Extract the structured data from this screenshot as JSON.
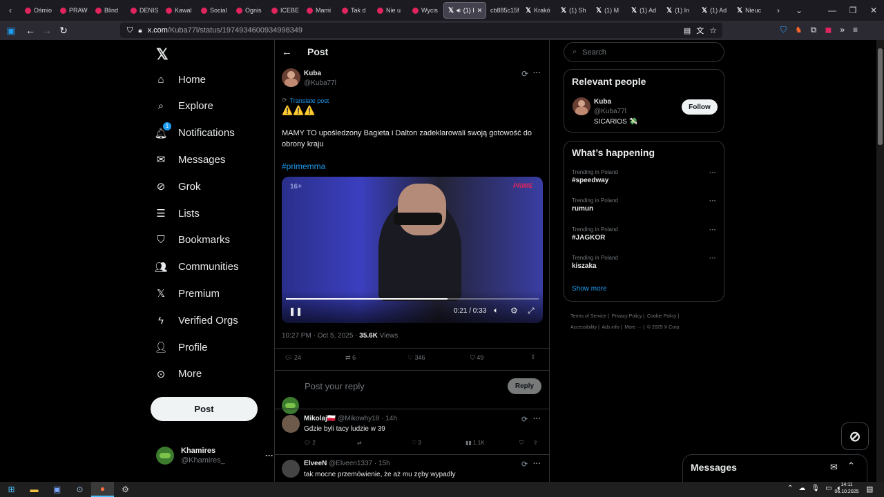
{
  "browser": {
    "tabs": [
      {
        "label": "Ośmio",
        "icon": "youtube-icon"
      },
      {
        "label": "PRAW",
        "icon": "youtube-icon"
      },
      {
        "label": "Blind",
        "icon": "youtube-icon"
      },
      {
        "label": "DENIS",
        "icon": "youtube-icon"
      },
      {
        "label": "Kawal",
        "icon": "youtube-icon"
      },
      {
        "label": "Social",
        "icon": "youtube-icon"
      },
      {
        "label": "Ognis",
        "icon": "youtube-icon"
      },
      {
        "label": "ICEBE",
        "icon": "youtube-icon"
      },
      {
        "label": "Mami",
        "icon": "youtube-icon"
      },
      {
        "label": "Tak d",
        "icon": "youtube-icon"
      },
      {
        "label": "Nie u",
        "icon": "youtube-icon"
      },
      {
        "label": "Wycis",
        "icon": "youtube-icon"
      },
      {
        "label": "(1) I",
        "icon": "x-icon",
        "active": true
      },
      {
        "label": "cb885c15f",
        "icon": "none"
      },
      {
        "label": "Krakó",
        "icon": "x-icon"
      },
      {
        "label": "(1) Sh",
        "icon": "x-icon"
      },
      {
        "label": "(1) M",
        "icon": "x-icon"
      },
      {
        "label": "(1) Ad",
        "icon": "x-icon"
      },
      {
        "label": "(1) In",
        "icon": "x-icon"
      },
      {
        "label": "(1) Ad",
        "icon": "x-icon"
      },
      {
        "label": "Nieuc",
        "icon": "x-icon"
      }
    ],
    "url_host": "x.com",
    "url_path": "/Kuba77l/status/1974934600934998349"
  },
  "nav": {
    "items": [
      {
        "label": "Home",
        "icon": "home-icon"
      },
      {
        "label": "Explore",
        "icon": "search-icon"
      },
      {
        "label": "Notifications",
        "icon": "bell-icon"
      },
      {
        "label": "Messages",
        "icon": "mail-icon"
      },
      {
        "label": "Grok",
        "icon": "grok-icon"
      },
      {
        "label": "Lists",
        "icon": "list-icon"
      },
      {
        "label": "Bookmarks",
        "icon": "bookmark-icon"
      },
      {
        "label": "Communities",
        "icon": "people-icon"
      },
      {
        "label": "Premium",
        "icon": "x-logo-icon"
      },
      {
        "label": "Verified Orgs",
        "icon": "bolt-icon"
      },
      {
        "label": "Profile",
        "icon": "person-icon"
      },
      {
        "label": "More",
        "icon": "more-circle-icon"
      }
    ],
    "notifications_badge": "1",
    "post_label": "Post",
    "account": {
      "name": "Khamires",
      "handle": "@Khamires_"
    }
  },
  "post": {
    "header_title": "Post",
    "author": {
      "name": "Kuba",
      "handle": "@Kuba77l"
    },
    "translate_label": "Translate post",
    "emoji_line": "⚠️⚠️⚠️",
    "text": "MAMY TO upośledzony Bagieta i Dalton zadeklarowali swoją gotowość do obrony kraju",
    "hashtag": "#primemma",
    "video": {
      "age_badge": "16+",
      "brand": "PRIME",
      "time": "0:21 / 0:33",
      "progress": 0.64
    },
    "meta_time": "10:27 PM · Oct 5, 2025 · ",
    "views": "35.6K",
    "views_label": " Views",
    "stats": {
      "replies": "24",
      "reposts": "6",
      "likes": "346",
      "bookmarks": "49"
    },
    "reply_placeholder": "Post your reply",
    "reply_button": "Reply"
  },
  "replies": [
    {
      "name": "Mikolaj🇵🇱",
      "handle": "@Mikowhy18",
      "time": "· 14h",
      "text": "Gdzie byli tacy ludzie w 39",
      "replies": "2",
      "reposts": "",
      "likes": "3",
      "views": "1.1K"
    },
    {
      "name": "ElveeN",
      "handle": "@Elveen1337",
      "time": "· 15h",
      "text": "tak mocne przemówienie, że aż mu zęby wypadly"
    }
  ],
  "sidebar": {
    "search_placeholder": "Search",
    "relevant_title": "Relevant people",
    "relevant": {
      "name": "Kuba",
      "handle": "@Kuba77l",
      "bio": "SICARIOS 💸",
      "follow": "Follow"
    },
    "happening_title": "What’s happening",
    "trends": [
      {
        "context": "Trending in Poland",
        "topic": "#speedway"
      },
      {
        "context": "Trending in Poland",
        "topic": "rumun"
      },
      {
        "context": "Trending in Poland",
        "topic": "#JAGKOR"
      },
      {
        "context": "Trending in Poland",
        "topic": "kiszaka"
      }
    ],
    "show_more": "Show more",
    "footer": [
      "Terms of Service",
      "Privacy Policy",
      "Cookie Policy",
      "Accessibility",
      "Ads info",
      "More ···",
      "© 2025 X Corp."
    ]
  },
  "messages_dock": {
    "label": "Messages"
  },
  "taskbar": {
    "time": "14:11",
    "date": "06.10.2025"
  }
}
